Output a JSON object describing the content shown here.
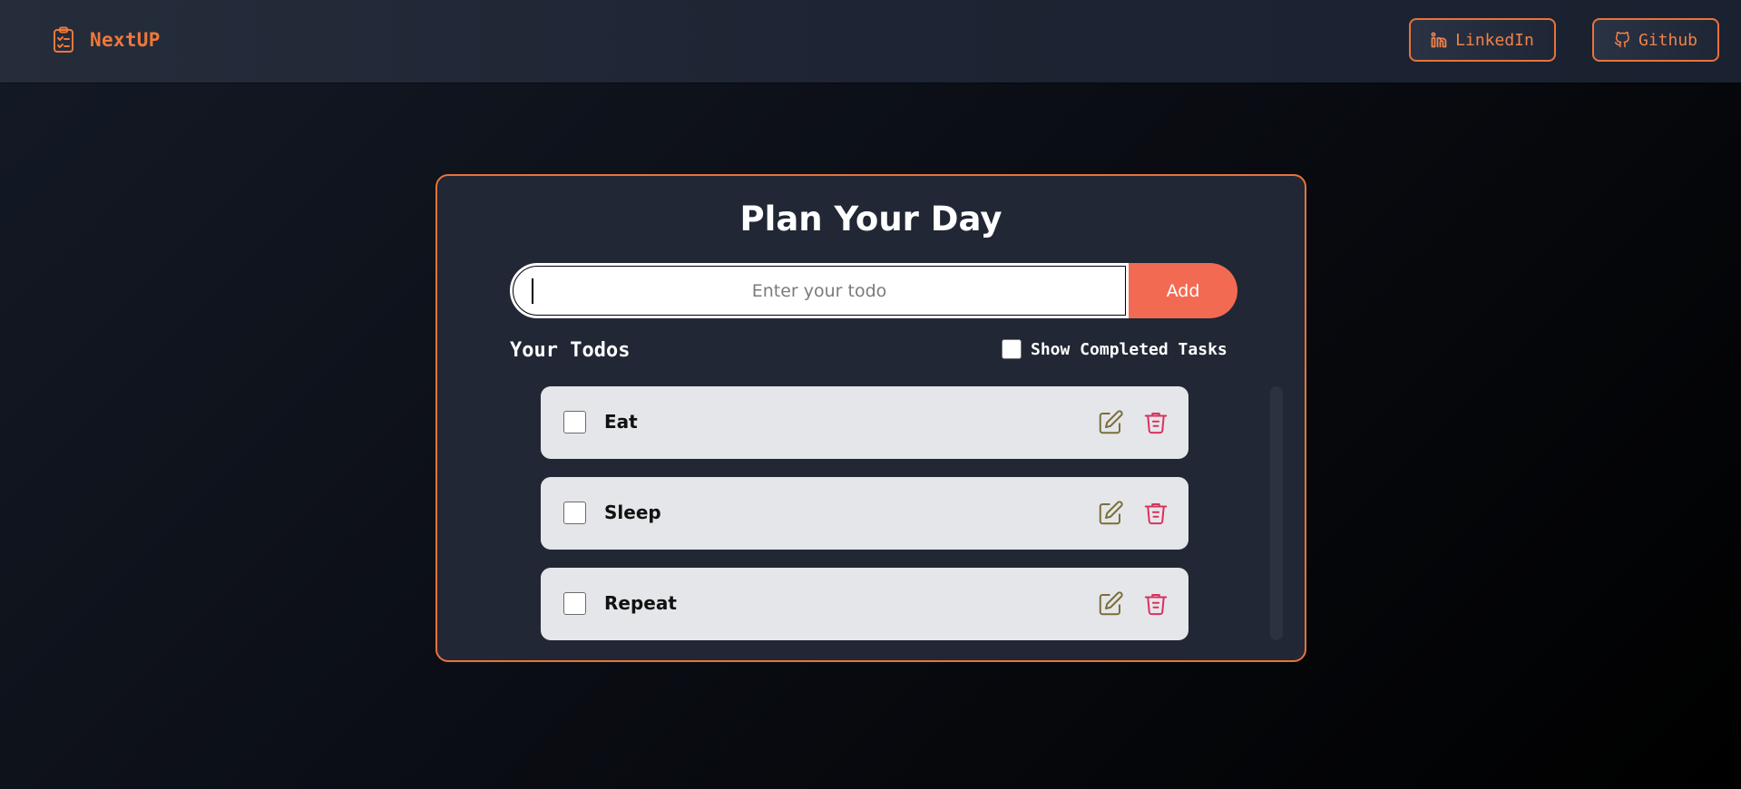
{
  "colors": {
    "accent": "#e8733a",
    "add_button": "#f36a52",
    "edit_icon": "#7a6f3a",
    "delete_icon": "#d8325f",
    "card_bg": "#212734",
    "todo_bg": "#e5e6e9"
  },
  "navbar": {
    "brand_icon": "clipboard-check-icon",
    "brand": "NextUP",
    "linkedin_icon": "linkedin-icon",
    "linkedin_label": "LinkedIn",
    "github_icon": "github-icon",
    "github_label": "Github"
  },
  "main": {
    "title": "Plan Your Day",
    "input": {
      "placeholder": "Enter your todo",
      "value": ""
    },
    "add_label": "Add",
    "todos_heading": "Your Todos",
    "show_completed_label": "Show Completed Tasks",
    "show_completed_checked": false,
    "todos": [
      {
        "text": "Eat",
        "completed": false
      },
      {
        "text": "Sleep",
        "completed": false
      },
      {
        "text": "Repeat",
        "completed": false
      }
    ],
    "edit_icon": "edit-icon",
    "delete_icon": "trash-icon"
  }
}
